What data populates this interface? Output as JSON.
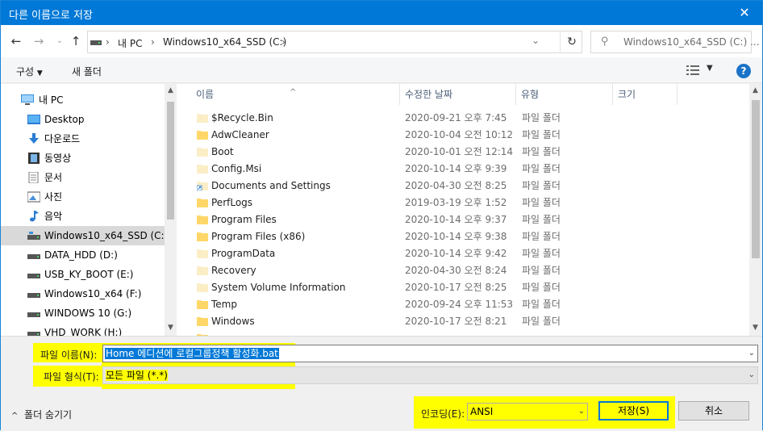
{
  "window": {
    "title": "다른 이름으로 저장",
    "close_glyph": "✕"
  },
  "address": {
    "crumbs": [
      "내 PC",
      "Windows10_x64_SSD (C:)"
    ],
    "separator": "›"
  },
  "search": {
    "placeholder": "Windows10_x64_SSD (C:) ..."
  },
  "toolbar": {
    "organize_label": "구성",
    "new_folder_label": "새 폴더"
  },
  "nav": {
    "items": [
      {
        "label": "내 PC",
        "icon": "pc-icon"
      },
      {
        "label": "Desktop",
        "icon": "desktop-folder-icon"
      },
      {
        "label": "다운로드",
        "icon": "download-icon"
      },
      {
        "label": "동영상",
        "icon": "video-icon"
      },
      {
        "label": "문서",
        "icon": "document-icon"
      },
      {
        "label": "사진",
        "icon": "picture-icon"
      },
      {
        "label": "음악",
        "icon": "music-icon"
      },
      {
        "label": "Windows10_x64_SSD (C:)",
        "icon": "drive-icon",
        "selected": true
      },
      {
        "label": "DATA_HDD (D:)",
        "icon": "drive-icon"
      },
      {
        "label": "USB_KY_BOOT (E:)",
        "icon": "drive-icon"
      },
      {
        "label": "Windows10_x64 (F:)",
        "icon": "drive-icon"
      },
      {
        "label": "WINDOWS 10 (G:)",
        "icon": "drive-icon"
      },
      {
        "label": "VHD_WORK (H:)",
        "icon": "drive-icon"
      }
    ]
  },
  "columns": {
    "name": "이름",
    "modified": "수정한 날짜",
    "type": "유형",
    "size": "크기"
  },
  "files": [
    {
      "name": "$Recycle.Bin",
      "date": "2020-09-21 오후 7:45",
      "type": "파일 폴더",
      "faded": true
    },
    {
      "name": "AdwCleaner",
      "date": "2020-10-04 오전 10:12",
      "type": "파일 폴더"
    },
    {
      "name": "Boot",
      "date": "2020-10-01 오전 12:14",
      "type": "파일 폴더",
      "faded": true
    },
    {
      "name": "Config.Msi",
      "date": "2020-10-14 오후 9:39",
      "type": "파일 폴더",
      "faded": true
    },
    {
      "name": "Documents and Settings",
      "date": "2020-04-30 오전 8:25",
      "type": "파일 폴더",
      "shortcut": true
    },
    {
      "name": "PerfLogs",
      "date": "2019-03-19 오후 1:52",
      "type": "파일 폴더"
    },
    {
      "name": "Program Files",
      "date": "2020-10-14 오후 9:37",
      "type": "파일 폴더"
    },
    {
      "name": "Program Files (x86)",
      "date": "2020-10-14 오후 9:38",
      "type": "파일 폴더"
    },
    {
      "name": "ProgramData",
      "date": "2020-10-14 오후 9:42",
      "type": "파일 폴더",
      "faded": true
    },
    {
      "name": "Recovery",
      "date": "2020-04-30 오전 8:24",
      "type": "파일 폴더",
      "faded": true
    },
    {
      "name": "System Volume Information",
      "date": "2020-10-17 오전 8:25",
      "type": "파일 폴더",
      "faded": true
    },
    {
      "name": "Temp",
      "date": "2020-09-24 오후 11:53",
      "type": "파일 폴더"
    },
    {
      "name": "Windows",
      "date": "2020-10-17 오전 8:21",
      "type": "파일 폴더"
    }
  ],
  "save_form": {
    "filename_label": "파일 이름(N):",
    "filename_value": "Home 에디션에 로컬그룹정책 활성화.bat",
    "filetype_label": "파일 형식(T):",
    "filetype_value": "모든 파일 (*.*)",
    "encoding_label": "인코딩(E):",
    "encoding_value": "ANSI",
    "save_label": "저장(S)",
    "cancel_label": "취소",
    "hide_folders_label": "폴더 숨기기"
  },
  "colors": {
    "titlebar": "#0078d7",
    "highlight": "#ffff00",
    "folder": "#ffd768",
    "folder_faded": "#fbeec6"
  }
}
